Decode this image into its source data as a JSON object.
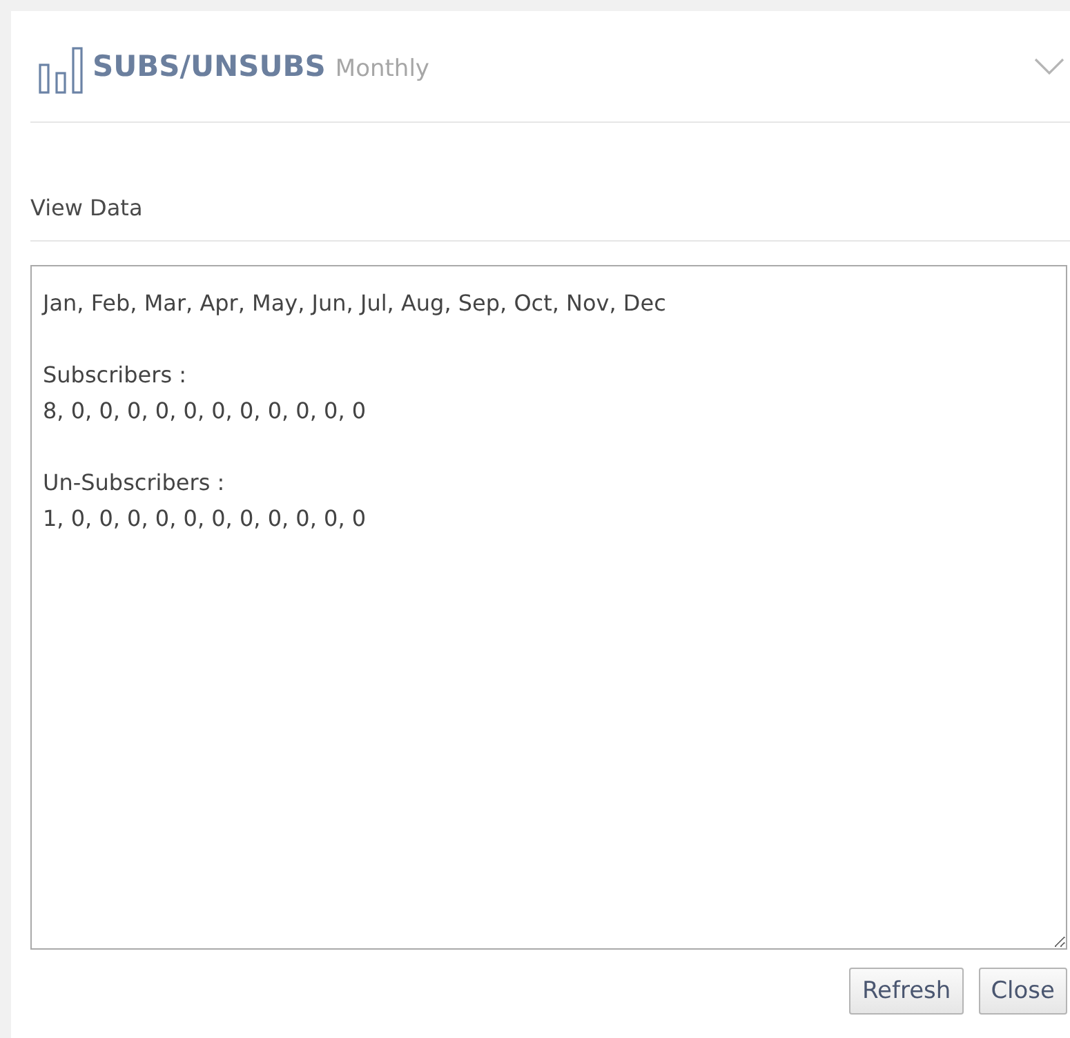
{
  "header": {
    "title": "SUBS/UNSUBS",
    "subtitle": "Monthly"
  },
  "section": {
    "label": "View Data"
  },
  "data_text": {
    "value": "Jan, Feb, Mar, Apr, May, Jun, Jul, Aug, Sep, Oct, Nov, Dec\n\nSubscribers :\n8, 0, 0, 0, 0, 0, 0, 0, 0, 0, 0, 0\n\nUn-Subscribers :\n1, 0, 0, 0, 0, 0, 0, 0, 0, 0, 0, 0"
  },
  "buttons": [
    "Refresh",
    "Close"
  ]
}
